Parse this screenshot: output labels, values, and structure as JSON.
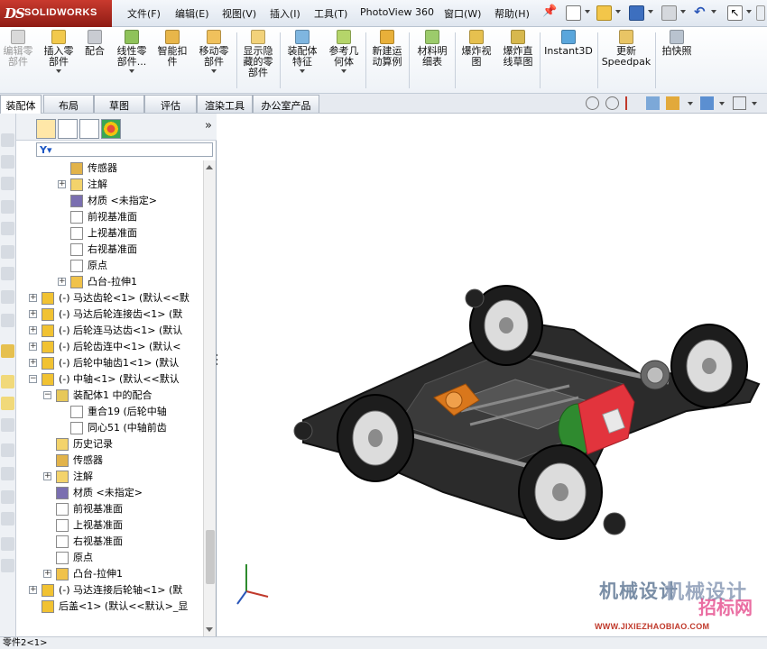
{
  "app": {
    "brand_ds": "DS",
    "brand_name": "SOLIDWORKS"
  },
  "menu": [
    "文件(F)",
    "编辑(E)",
    "视图(V)",
    "插入(I)",
    "工具(T)",
    "PhotoView 360",
    "窗口(W)",
    "帮助(H)"
  ],
  "commands": [
    {
      "label": "编辑零\n部件",
      "disabled": true
    },
    {
      "label": "插入零\n部件",
      "dropdown": true
    },
    {
      "label": "配合"
    },
    {
      "label": "线性零\n部件...",
      "dropdown": true
    },
    {
      "label": "智能扣\n件"
    },
    {
      "label": "移动零\n部件",
      "dropdown": true
    },
    {
      "label": "显示隐\n藏的零\n部件"
    },
    {
      "label": "装配体\n特征",
      "dropdown": true
    },
    {
      "label": "参考几\n何体",
      "dropdown": true
    },
    {
      "label": "新建运\n动算例"
    },
    {
      "label": "材料明\n细表"
    },
    {
      "label": "爆炸视\n图"
    },
    {
      "label": "爆炸直\n线草图"
    },
    {
      "label": "Instant3D"
    },
    {
      "label": "更新\nSpeedpak"
    },
    {
      "label": "拍快照"
    }
  ],
  "tabs": [
    "装配体",
    "布局",
    "草图",
    "评估",
    "渲染工具",
    "办公室产品"
  ],
  "feature_tree": [
    {
      "label": "传感器",
      "icon": "sensor-icon",
      "indent": 2
    },
    {
      "label": "注解",
      "icon": "annotation-icon",
      "indent": 2,
      "expandable": true
    },
    {
      "label": "材质 <未指定>",
      "icon": "material-icon",
      "indent": 2
    },
    {
      "label": "前视基准面",
      "icon": "plane-icon",
      "indent": 2
    },
    {
      "label": "上视基准面",
      "icon": "plane-icon",
      "indent": 2
    },
    {
      "label": "右视基准面",
      "icon": "plane-icon",
      "indent": 2
    },
    {
      "label": "原点",
      "icon": "origin-icon",
      "indent": 2
    },
    {
      "label": "凸台-拉伸1",
      "icon": "extrude-icon",
      "indent": 2,
      "expandable": true
    },
    {
      "label": "(-) 马达齿轮<1> (默认<<默",
      "icon": "part-icon",
      "indent": 0,
      "expandable": true
    },
    {
      "label": "(-) 马达后轮连接齿<1> (默",
      "icon": "part-icon",
      "indent": 0,
      "expandable": true
    },
    {
      "label": "(-) 后轮连马达齿<1> (默认",
      "icon": "part-icon",
      "indent": 0,
      "expandable": true
    },
    {
      "label": "(-) 后轮齿连中<1> (默认<",
      "icon": "part-icon",
      "indent": 0,
      "expandable": true
    },
    {
      "label": "(-) 后轮中轴齿1<1> (默认",
      "icon": "part-icon",
      "indent": 0,
      "expandable": true
    },
    {
      "label": "(-) 中轴<1> (默认<<默认",
      "icon": "part-icon",
      "indent": 0,
      "expanded": true
    },
    {
      "label": "装配体1 中的配合",
      "icon": "mates-icon",
      "indent": 1,
      "expanded": true
    },
    {
      "label": "重合19 (后轮中轴",
      "icon": "coincident-icon",
      "indent": 2
    },
    {
      "label": "同心51 (中轴前齿",
      "icon": "concentric-icon",
      "indent": 2
    },
    {
      "label": "历史记录",
      "icon": "history-icon",
      "indent": 1
    },
    {
      "label": "传感器",
      "icon": "sensor-icon",
      "indent": 1
    },
    {
      "label": "注解",
      "icon": "annotation-icon",
      "indent": 1,
      "expandable": true
    },
    {
      "label": "材质 <未指定>",
      "icon": "material-icon",
      "indent": 1
    },
    {
      "label": "前视基准面",
      "icon": "plane-icon",
      "indent": 1
    },
    {
      "label": "上视基准面",
      "icon": "plane-icon",
      "indent": 1
    },
    {
      "label": "右视基准面",
      "icon": "plane-icon",
      "indent": 1
    },
    {
      "label": "原点",
      "icon": "origin-icon",
      "indent": 1
    },
    {
      "label": "凸台-拉伸1",
      "icon": "extrude-icon",
      "indent": 1,
      "expandable": true
    },
    {
      "label": "(-) 马达连接后轮轴<1> (默",
      "icon": "part-icon",
      "indent": 0,
      "expandable": true
    },
    {
      "label": "后盖<1> (默认<<默认>_显",
      "icon": "part-icon",
      "indent": 0
    }
  ],
  "filter_icon": "filter-icon",
  "watermark": {
    "title": "机械设计",
    "title2": "机械设计",
    "title3": "招标网",
    "url": "WWW.JIXIEZHAOBIAO.COM"
  },
  "status_text": "零件2<1>",
  "colors": {
    "brand_red": "#b3271d",
    "motor_red": "#e2343d",
    "gear_orange": "#d9771c",
    "chassis": "#2b2b2b"
  }
}
